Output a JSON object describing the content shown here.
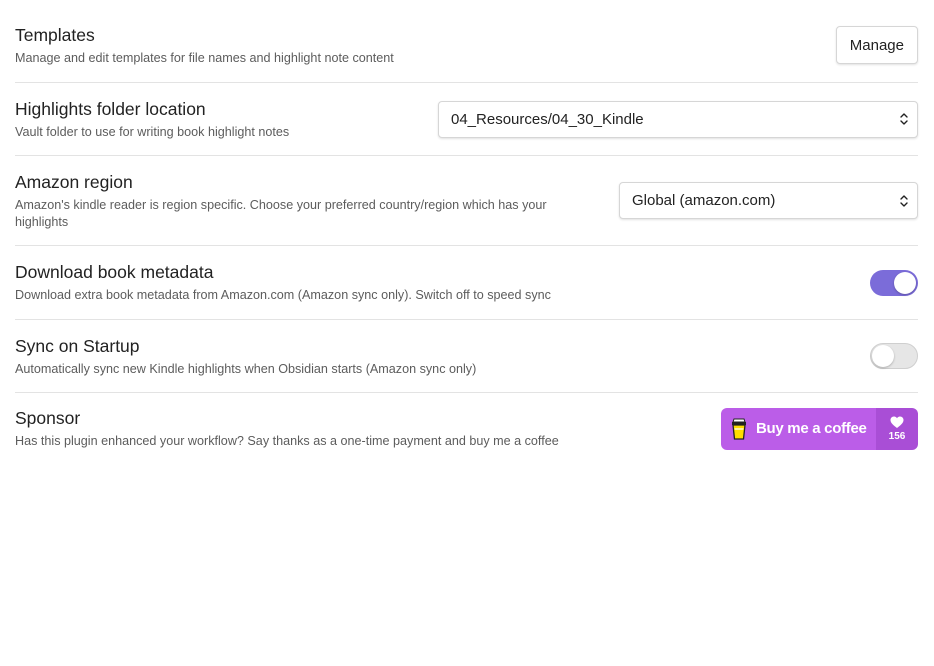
{
  "settings": {
    "templates": {
      "name": "Templates",
      "desc": "Manage and edit templates for file names and highlight note content",
      "button_label": "Manage"
    },
    "highlights_folder": {
      "name": "Highlights folder location",
      "desc": "Vault folder to use for writing book highlight notes",
      "selected": "04_Resources/04_30_Kindle"
    },
    "amazon_region": {
      "name": "Amazon region",
      "desc": "Amazon's kindle reader is region specific. Choose your preferred country/region which has your highlights",
      "selected": "Global (amazon.com)"
    },
    "download_metadata": {
      "name": "Download book metadata",
      "desc": "Download extra book metadata from Amazon.com (Amazon sync only). Switch off to speed sync",
      "enabled": true
    },
    "sync_on_startup": {
      "name": "Sync on Startup",
      "desc": "Automatically sync new Kindle highlights when Obsidian starts (Amazon sync only)",
      "enabled": false
    },
    "sponsor": {
      "name": "Sponsor",
      "desc": "Has this plugin enhanced your workflow? Say thanks as a one-time payment and buy me a coffee",
      "button_label": "Buy me a coffee",
      "supporter_count": "156"
    }
  },
  "colors": {
    "accent": "#7b6cd9",
    "bmc_purple": "#bb5de8",
    "bmc_count_bg": "#a94ed6"
  },
  "icons": {
    "select_chevron": "chevron-up-down-icon",
    "bmc_cup": "coffee-cup-icon",
    "bmc_heart": "heart-icon"
  }
}
